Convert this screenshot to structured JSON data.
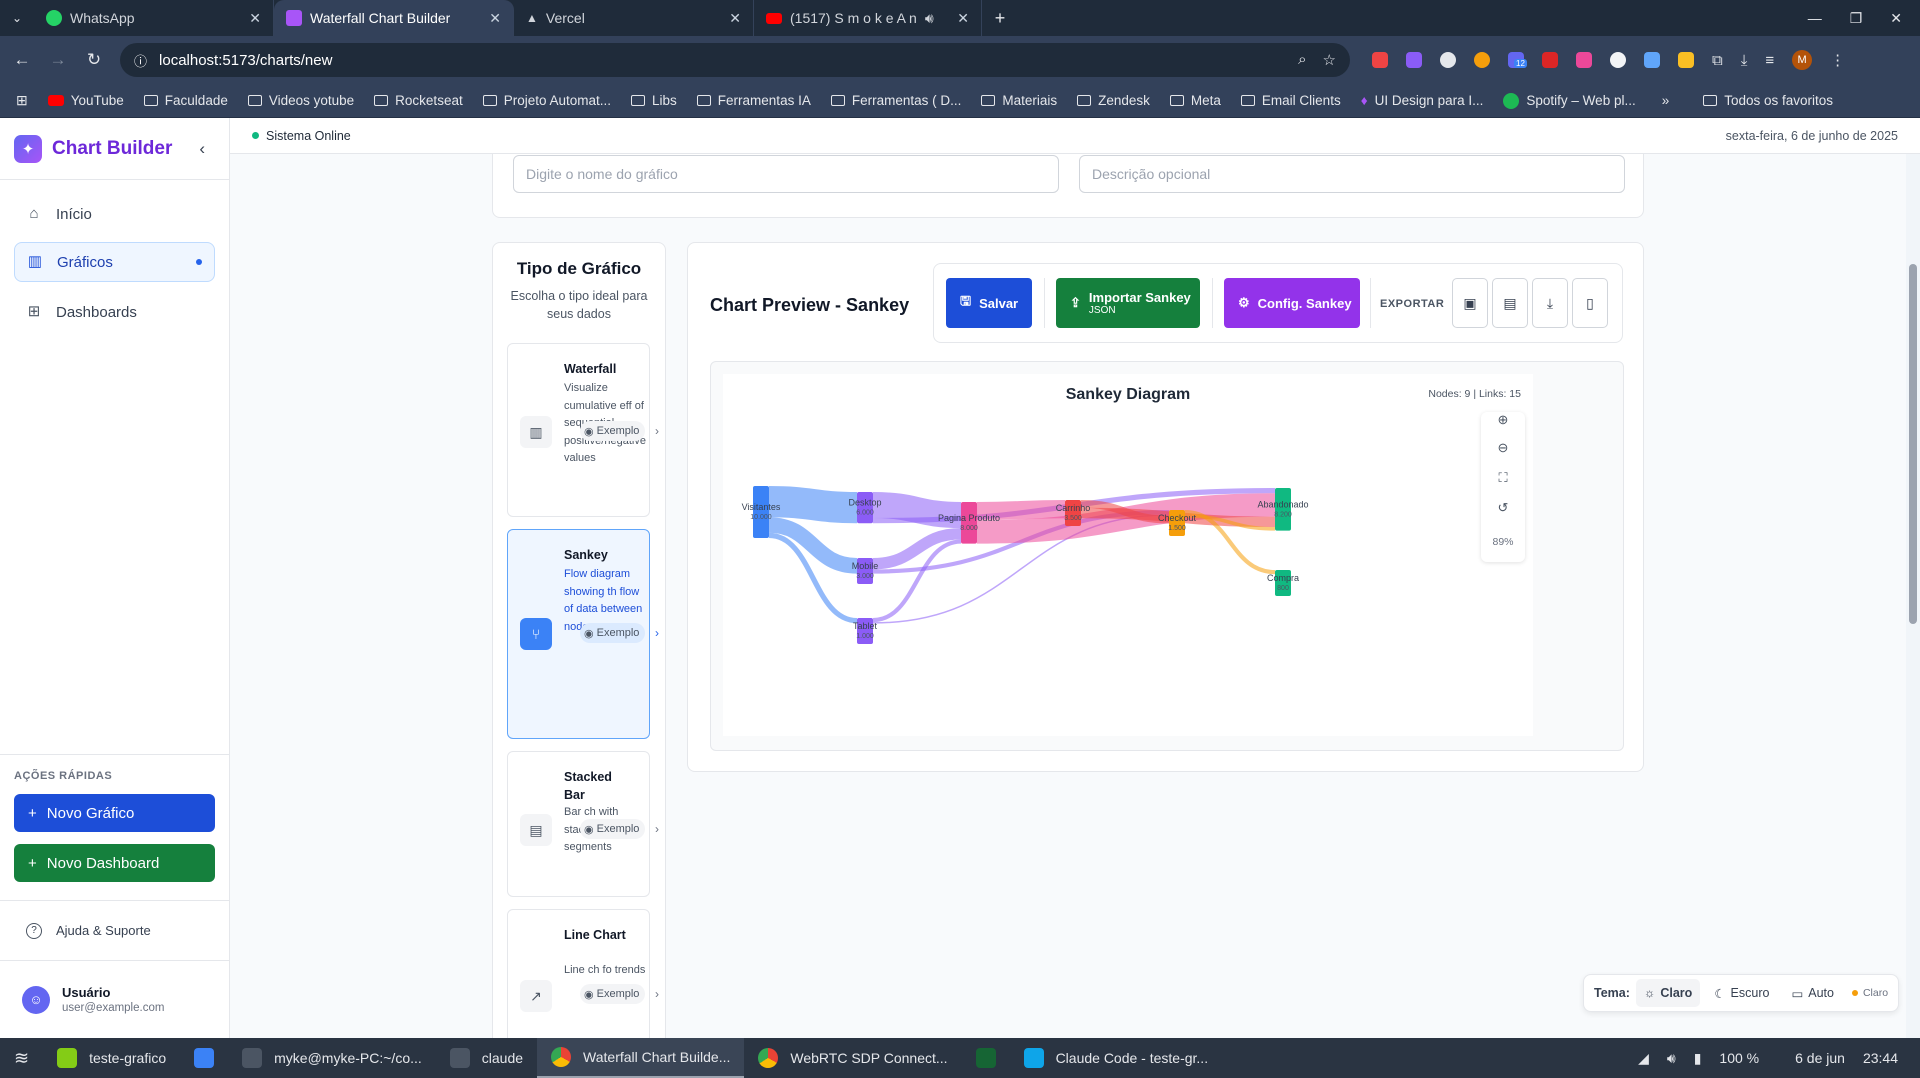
{
  "browser": {
    "tabs": [
      {
        "title": "WhatsApp",
        "favicon_color": "#25d366",
        "active": false
      },
      {
        "title": "Waterfall Chart Builder",
        "favicon_color": "#a855f7",
        "active": true
      },
      {
        "title": "Vercel",
        "favicon_color": "#ffffff",
        "active": false
      },
      {
        "title": "(1517) S m o k e    A n",
        "favicon_color": "#ff0000",
        "active": false
      }
    ],
    "url": "localhost:5173/charts/new",
    "bookmarks": [
      "YouTube",
      "Faculdade",
      "Videos yotube",
      "Rocketseat",
      "Projeto Automat...",
      "Libs",
      "Ferramentas IA",
      "Ferramentas ( D...",
      "Materiais",
      "Zendesk",
      "Meta",
      "Email Clients",
      "UI Design para I...",
      "Spotify – Web pl..."
    ],
    "all_bookmarks": "Todos os favoritos",
    "profile_initial": "M",
    "ext_badge": "12"
  },
  "sidebar": {
    "brand": "Chart Builder",
    "nav": [
      {
        "label": "Início",
        "icon": "home-icon",
        "glyph": "⌂"
      },
      {
        "label": "Gráficos",
        "icon": "bar-chart-icon",
        "glyph": "▥",
        "active": true
      },
      {
        "label": "Dashboards",
        "icon": "grid-icon",
        "glyph": "⊞"
      }
    ],
    "quick_title": "AÇÕES RÁPIDAS",
    "quick_actions": [
      {
        "label": "Novo Gráfico",
        "color": "#1d4ed8"
      },
      {
        "label": "Novo Dashboard",
        "color": "#15803d"
      }
    ],
    "help": "Ajuda & Suporte",
    "user_name": "Usuário",
    "user_email": "user@example.com"
  },
  "topbar": {
    "status": "Sistema Online",
    "date": "sexta-feira, 6 de junho de 2025"
  },
  "form": {
    "name_placeholder": "Digite o nome do gráfico",
    "desc_placeholder": "Descrição opcional"
  },
  "chart_types": {
    "title": "Tipo de Gráfico",
    "subtitle": "Escolha o tipo ideal para seus dados",
    "example_label": "Exemplo",
    "items": [
      {
        "name": "Waterfall",
        "desc": "Visualize cumulative eff of sequential positive/negative values",
        "icon": "bar-chart-icon",
        "glyph": "▥"
      },
      {
        "name": "Sankey",
        "desc": "Flow diagram showing th flow of data between nodes",
        "icon": "git-branch-icon",
        "glyph": "⑂",
        "selected": true
      },
      {
        "name": "Stacked Bar",
        "desc": "Bar ch with stacked segments",
        "icon": "stacked-bar-icon",
        "glyph": "▤"
      },
      {
        "name": "Line Chart",
        "desc": "Line ch fo trends",
        "icon": "trending-up-icon",
        "glyph": "↗"
      }
    ]
  },
  "preview": {
    "title": "Chart Preview - Sankey",
    "save": "Salvar",
    "import": "Importar Sankey",
    "import_sub": "JSON",
    "config": "Config. Sankey",
    "export": "EXPORTAR",
    "colors": {
      "save": "#1d4ed8",
      "import": "#15803d",
      "config": "#9333ea"
    }
  },
  "chart_data": {
    "type": "sankey",
    "title": "Sankey Diagram",
    "meta": "Nodes: 9 | Links: 15",
    "zoom": "89%",
    "nodes": [
      {
        "id": "visitantes",
        "name": "Visitantes",
        "value": "10.000",
        "value_num": 10000,
        "color": "#3b82f6"
      },
      {
        "id": "desktop",
        "name": "Desktop",
        "value": "6.000",
        "value_num": 6000,
        "color": "#8b5cf6"
      },
      {
        "id": "mobile",
        "name": "Mobile",
        "value": "3.000",
        "value_num": 3000,
        "color": "#8b5cf6"
      },
      {
        "id": "tablet",
        "name": "Tablet",
        "value": "1.000",
        "value_num": 1000,
        "color": "#8b5cf6"
      },
      {
        "id": "produto",
        "name": "Pagina Produto",
        "value": "8.000",
        "value_num": 8000,
        "color": "#ec4899"
      },
      {
        "id": "carrinho",
        "name": "Carrinho",
        "value": "3.500",
        "value_num": 3500,
        "color": "#ef4444"
      },
      {
        "id": "checkout",
        "name": "Checkout",
        "value": "1.500",
        "value_num": 1500,
        "color": "#f59e0b"
      },
      {
        "id": "abandonado",
        "name": "Abandonado",
        "value": "8.200",
        "value_num": 8200,
        "color": "#10b981"
      },
      {
        "id": "compra",
        "name": "Compra",
        "value": "800",
        "value_num": 800,
        "color": "#10b981"
      }
    ],
    "links": [
      {
        "source": "visitantes",
        "target": "desktop",
        "value": 6000
      },
      {
        "source": "visitantes",
        "target": "mobile",
        "value": 3000
      },
      {
        "source": "visitantes",
        "target": "tablet",
        "value": 1000
      },
      {
        "source": "desktop",
        "target": "produto",
        "value": 5000
      },
      {
        "source": "desktop",
        "target": "abandonado",
        "value": 1000
      },
      {
        "source": "mobile",
        "target": "produto",
        "value": 2200
      },
      {
        "source": "mobile",
        "target": "checkout",
        "value": 800
      },
      {
        "source": "tablet",
        "target": "produto",
        "value": 800
      },
      {
        "source": "tablet",
        "target": "checkout",
        "value": 200
      },
      {
        "source": "produto",
        "target": "carrinho",
        "value": 3500
      },
      {
        "source": "produto",
        "target": "abandonado",
        "value": 4500
      },
      {
        "source": "carrinho",
        "target": "checkout",
        "value": 1500
      },
      {
        "source": "carrinho",
        "target": "abandonado",
        "value": 2000
      },
      {
        "source": "checkout",
        "target": "compra",
        "value": 800
      },
      {
        "source": "checkout",
        "target": "abandonado",
        "value": 700
      }
    ]
  },
  "theme": {
    "label": "Tema:",
    "light": "Claro",
    "dark": "Escuro",
    "auto": "Auto",
    "current": "Claro"
  },
  "taskbar": {
    "items": [
      "teste-grafico",
      "myke@myke-PC:~/co...",
      "claude",
      "Waterfall Chart Builde...",
      "WebRTC SDP Connect...",
      "Claude Code - teste-gr..."
    ],
    "battery": "100 %",
    "date": "6 de jun",
    "time": "23:44"
  }
}
